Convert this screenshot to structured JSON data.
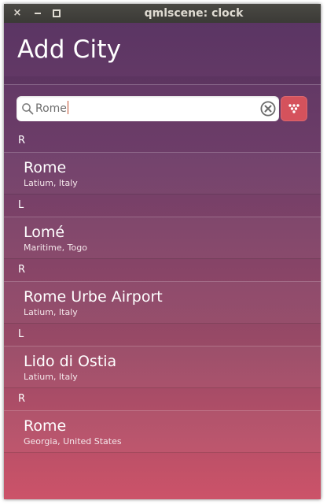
{
  "window": {
    "title": "qmlscene: clock",
    "close_glyph": "×",
    "colors": {
      "titlebar": "#3c3b37",
      "bg_top": "#583463",
      "bg_bottom": "#cc5369",
      "accent_button": "#d5525c"
    }
  },
  "header": {
    "title": "Add City"
  },
  "search": {
    "value": "Rome",
    "search_icon": "magnifier-icon",
    "clear_icon": "clear-circle-icon",
    "button_icon": "location-dots-icon"
  },
  "results": [
    {
      "section": "R",
      "name": "Rome",
      "region": "Latium, Italy"
    },
    {
      "section": "L",
      "name": "Lomé",
      "region": "Maritime, Togo"
    },
    {
      "section": "R",
      "name": "Rome Urbe Airport",
      "region": "Latium, Italy"
    },
    {
      "section": "L",
      "name": "Lido di Ostia",
      "region": "Latium, Italy"
    },
    {
      "section": "R",
      "name": "Rome",
      "region": "Georgia, United States"
    }
  ]
}
